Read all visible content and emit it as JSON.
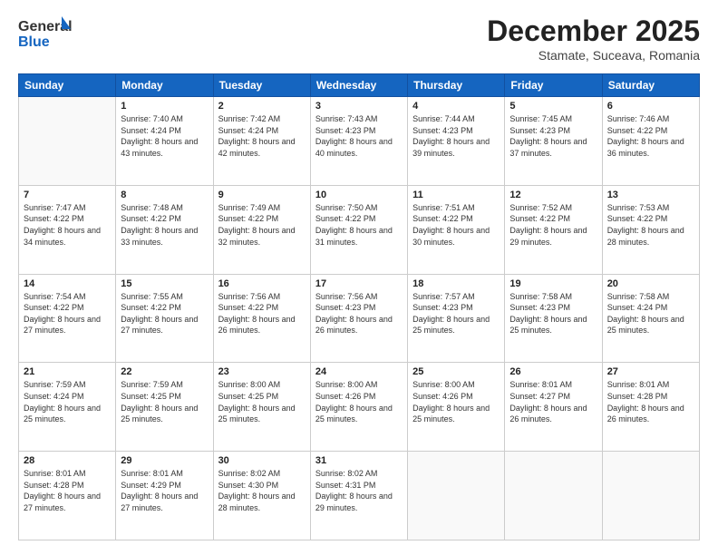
{
  "header": {
    "logo_general": "General",
    "logo_blue": "Blue",
    "month": "December 2025",
    "location": "Stamate, Suceava, Romania"
  },
  "days_of_week": [
    "Sunday",
    "Monday",
    "Tuesday",
    "Wednesday",
    "Thursday",
    "Friday",
    "Saturday"
  ],
  "weeks": [
    [
      {
        "day": "",
        "sunrise": "",
        "sunset": "",
        "daylight": ""
      },
      {
        "day": "1",
        "sunrise": "Sunrise: 7:40 AM",
        "sunset": "Sunset: 4:24 PM",
        "daylight": "Daylight: 8 hours and 43 minutes."
      },
      {
        "day": "2",
        "sunrise": "Sunrise: 7:42 AM",
        "sunset": "Sunset: 4:24 PM",
        "daylight": "Daylight: 8 hours and 42 minutes."
      },
      {
        "day": "3",
        "sunrise": "Sunrise: 7:43 AM",
        "sunset": "Sunset: 4:23 PM",
        "daylight": "Daylight: 8 hours and 40 minutes."
      },
      {
        "day": "4",
        "sunrise": "Sunrise: 7:44 AM",
        "sunset": "Sunset: 4:23 PM",
        "daylight": "Daylight: 8 hours and 39 minutes."
      },
      {
        "day": "5",
        "sunrise": "Sunrise: 7:45 AM",
        "sunset": "Sunset: 4:23 PM",
        "daylight": "Daylight: 8 hours and 37 minutes."
      },
      {
        "day": "6",
        "sunrise": "Sunrise: 7:46 AM",
        "sunset": "Sunset: 4:22 PM",
        "daylight": "Daylight: 8 hours and 36 minutes."
      }
    ],
    [
      {
        "day": "7",
        "sunrise": "Sunrise: 7:47 AM",
        "sunset": "Sunset: 4:22 PM",
        "daylight": "Daylight: 8 hours and 34 minutes."
      },
      {
        "day": "8",
        "sunrise": "Sunrise: 7:48 AM",
        "sunset": "Sunset: 4:22 PM",
        "daylight": "Daylight: 8 hours and 33 minutes."
      },
      {
        "day": "9",
        "sunrise": "Sunrise: 7:49 AM",
        "sunset": "Sunset: 4:22 PM",
        "daylight": "Daylight: 8 hours and 32 minutes."
      },
      {
        "day": "10",
        "sunrise": "Sunrise: 7:50 AM",
        "sunset": "Sunset: 4:22 PM",
        "daylight": "Daylight: 8 hours and 31 minutes."
      },
      {
        "day": "11",
        "sunrise": "Sunrise: 7:51 AM",
        "sunset": "Sunset: 4:22 PM",
        "daylight": "Daylight: 8 hours and 30 minutes."
      },
      {
        "day": "12",
        "sunrise": "Sunrise: 7:52 AM",
        "sunset": "Sunset: 4:22 PM",
        "daylight": "Daylight: 8 hours and 29 minutes."
      },
      {
        "day": "13",
        "sunrise": "Sunrise: 7:53 AM",
        "sunset": "Sunset: 4:22 PM",
        "daylight": "Daylight: 8 hours and 28 minutes."
      }
    ],
    [
      {
        "day": "14",
        "sunrise": "Sunrise: 7:54 AM",
        "sunset": "Sunset: 4:22 PM",
        "daylight": "Daylight: 8 hours and 27 minutes."
      },
      {
        "day": "15",
        "sunrise": "Sunrise: 7:55 AM",
        "sunset": "Sunset: 4:22 PM",
        "daylight": "Daylight: 8 hours and 27 minutes."
      },
      {
        "day": "16",
        "sunrise": "Sunrise: 7:56 AM",
        "sunset": "Sunset: 4:22 PM",
        "daylight": "Daylight: 8 hours and 26 minutes."
      },
      {
        "day": "17",
        "sunrise": "Sunrise: 7:56 AM",
        "sunset": "Sunset: 4:23 PM",
        "daylight": "Daylight: 8 hours and 26 minutes."
      },
      {
        "day": "18",
        "sunrise": "Sunrise: 7:57 AM",
        "sunset": "Sunset: 4:23 PM",
        "daylight": "Daylight: 8 hours and 25 minutes."
      },
      {
        "day": "19",
        "sunrise": "Sunrise: 7:58 AM",
        "sunset": "Sunset: 4:23 PM",
        "daylight": "Daylight: 8 hours and 25 minutes."
      },
      {
        "day": "20",
        "sunrise": "Sunrise: 7:58 AM",
        "sunset": "Sunset: 4:24 PM",
        "daylight": "Daylight: 8 hours and 25 minutes."
      }
    ],
    [
      {
        "day": "21",
        "sunrise": "Sunrise: 7:59 AM",
        "sunset": "Sunset: 4:24 PM",
        "daylight": "Daylight: 8 hours and 25 minutes."
      },
      {
        "day": "22",
        "sunrise": "Sunrise: 7:59 AM",
        "sunset": "Sunset: 4:25 PM",
        "daylight": "Daylight: 8 hours and 25 minutes."
      },
      {
        "day": "23",
        "sunrise": "Sunrise: 8:00 AM",
        "sunset": "Sunset: 4:25 PM",
        "daylight": "Daylight: 8 hours and 25 minutes."
      },
      {
        "day": "24",
        "sunrise": "Sunrise: 8:00 AM",
        "sunset": "Sunset: 4:26 PM",
        "daylight": "Daylight: 8 hours and 25 minutes."
      },
      {
        "day": "25",
        "sunrise": "Sunrise: 8:00 AM",
        "sunset": "Sunset: 4:26 PM",
        "daylight": "Daylight: 8 hours and 25 minutes."
      },
      {
        "day": "26",
        "sunrise": "Sunrise: 8:01 AM",
        "sunset": "Sunset: 4:27 PM",
        "daylight": "Daylight: 8 hours and 26 minutes."
      },
      {
        "day": "27",
        "sunrise": "Sunrise: 8:01 AM",
        "sunset": "Sunset: 4:28 PM",
        "daylight": "Daylight: 8 hours and 26 minutes."
      }
    ],
    [
      {
        "day": "28",
        "sunrise": "Sunrise: 8:01 AM",
        "sunset": "Sunset: 4:28 PM",
        "daylight": "Daylight: 8 hours and 27 minutes."
      },
      {
        "day": "29",
        "sunrise": "Sunrise: 8:01 AM",
        "sunset": "Sunset: 4:29 PM",
        "daylight": "Daylight: 8 hours and 27 minutes."
      },
      {
        "day": "30",
        "sunrise": "Sunrise: 8:02 AM",
        "sunset": "Sunset: 4:30 PM",
        "daylight": "Daylight: 8 hours and 28 minutes."
      },
      {
        "day": "31",
        "sunrise": "Sunrise: 8:02 AM",
        "sunset": "Sunset: 4:31 PM",
        "daylight": "Daylight: 8 hours and 29 minutes."
      },
      {
        "day": "",
        "sunrise": "",
        "sunset": "",
        "daylight": ""
      },
      {
        "day": "",
        "sunrise": "",
        "sunset": "",
        "daylight": ""
      },
      {
        "day": "",
        "sunrise": "",
        "sunset": "",
        "daylight": ""
      }
    ]
  ]
}
